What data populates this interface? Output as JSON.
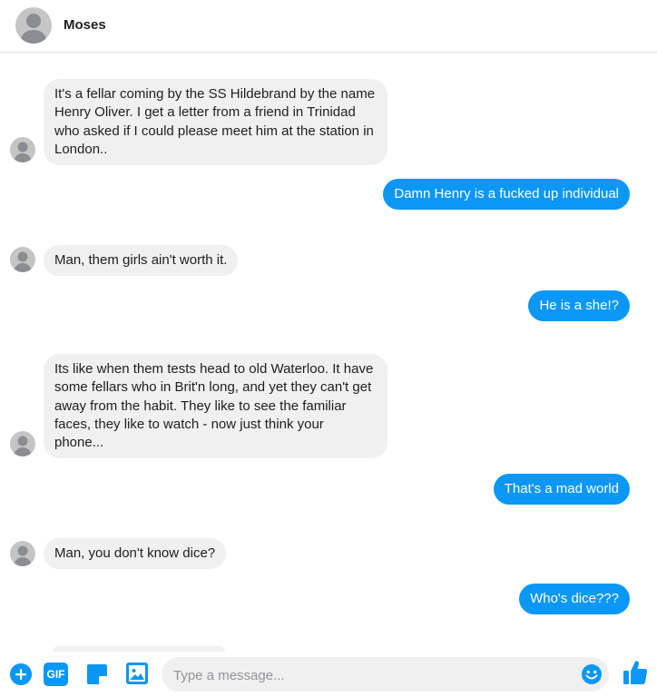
{
  "header": {
    "contact_name": "Moses"
  },
  "messages": [
    {
      "direction": "in",
      "text": "It's a fellar coming by the SS Hildebrand by the name Henry Oliver. I get a letter from a friend in Trinidad who asked if I could please meet him at the station in London.."
    },
    {
      "direction": "out",
      "text": "Damn Henry is a fucked up individual"
    },
    {
      "direction": "in",
      "text": "Man, them girls ain't worth it."
    },
    {
      "direction": "out",
      "text": "He is a she!?"
    },
    {
      "direction": "in",
      "text": "Its like when them tests head to old Waterloo. It have some fellars who in Brit'n long, and yet they can't get away from the habit. They like to see the familiar faces, they like to watch - now just think your phone..."
    },
    {
      "direction": "out",
      "text": "That's a mad world"
    },
    {
      "direction": "in",
      "text": "Man, you don't know dice?"
    },
    {
      "direction": "out",
      "text": "Who's dice???"
    }
  ],
  "composer": {
    "placeholder": "Type a message...",
    "value": "",
    "gif_label": "GIF"
  },
  "colors": {
    "accent": "#0a97f5",
    "incoming_bubble": "#f0f0f0",
    "avatar_gray": "#c5c5c5"
  },
  "icons": [
    "plus-icon",
    "gif-icon",
    "sticker-icon",
    "image-icon",
    "emoji-icon",
    "like-icon",
    "avatar"
  ]
}
